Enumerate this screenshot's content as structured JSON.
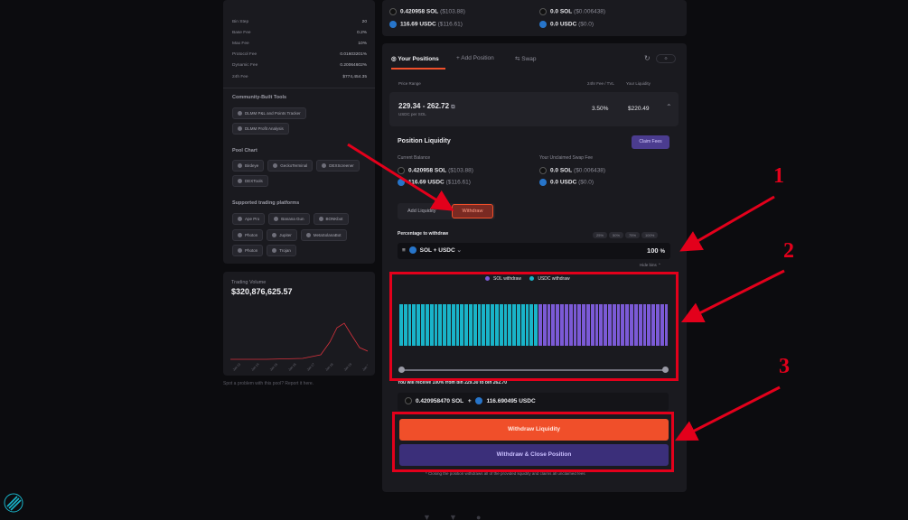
{
  "left_panel": {
    "stats": [
      {
        "label": "Bin Step",
        "value": "20"
      },
      {
        "label": "Base Fee",
        "value": "0.2%"
      },
      {
        "label": "Max Fee",
        "value": "10%"
      },
      {
        "label": "Protocol Fee",
        "value": "0.01603201%"
      },
      {
        "label": "Dynamic Fee",
        "value": "0.20064602%"
      },
      {
        "label": "24h Fee",
        "value": "$774,454.35"
      }
    ],
    "community_title": "Community-Built Tools",
    "community_tools": [
      "DLMM P&L and Points Tracker",
      "DLMM Profit Analysis"
    ],
    "pool_chart_title": "Pool Chart",
    "pool_chart_tools": [
      "Birdeye",
      "GeckoTerminal",
      "DEXScreener",
      "DEXTools"
    ],
    "platforms_title": "Supported trading platforms",
    "platforms": [
      "Ape Pro",
      "Banana Gun",
      "BONKbot",
      "Photon",
      "Jupiter",
      "MetaSolanaBot",
      "Photon",
      "Trojan"
    ]
  },
  "volume_panel": {
    "label": "Trading Volume",
    "value": "$320,876,625.57",
    "dates": [
      "Jan 13",
      "Jan 14",
      "Jan 15",
      "Jan 16",
      "Jan 17",
      "Jan 18",
      "Jan 19",
      "Jan 20"
    ]
  },
  "report_link": "Spot a problem with this pool? Report it here.",
  "balances_top": {
    "sol": "0.420958 SOL",
    "sol_usd": "($103.88)",
    "usdc": "116.69 USDC",
    "usdc_usd": "($116.61)",
    "fee_sol": "0.0 SOL",
    "fee_sol_usd": "($0.006438)",
    "fee_usdc": "0.0 USDC",
    "fee_usdc_usd": "($0.0)"
  },
  "tabs": {
    "positions": "Your Positions",
    "add": "+ Add Position",
    "swap": "Swap"
  },
  "table_headers": {
    "price_range": "Price Range",
    "fee_tvl": "24hr Fee / TVL",
    "liquidity": "Your Liquidity"
  },
  "position": {
    "range": "229.34 - 262.72",
    "unit": "USDC per SOL",
    "fee_pct": "3.50%",
    "liquidity": "$220.49"
  },
  "position_liquidity": {
    "title": "Position Liquidity",
    "claim_fees": "Claim Fees",
    "current_balance": "Current Balance",
    "unclaimed": "Your Unclaimed Swap Fee",
    "sol": "0.420958 SOL",
    "sol_usd": "($103.88)",
    "usdc": "116.69 USDC",
    "usdc_usd": "($116.61)",
    "fee_sol": "0.0 SOL",
    "fee_sol_usd": "($0.006438)",
    "fee_usdc": "0.0 USDC",
    "fee_usdc_usd": "($0.0)"
  },
  "actions": {
    "add_liquidity": "Add Liquidity",
    "withdraw": "Withdraw"
  },
  "withdraw": {
    "pct_label": "Percentage to withdraw",
    "pct_options": [
      "25%",
      "50%",
      "75%",
      "100%"
    ],
    "pair": "SOL + USDC",
    "pct_value": "100",
    "pct_sign": "%",
    "hide_bins": "Hide bins",
    "legend_sol": "SOL withdraw",
    "legend_usdc": "USDC withdraw",
    "receive_text": "You will receive 100% from bin 229.30 to bin 262.70",
    "summary_sol": "0.420958470 SOL",
    "summary_plus": "+",
    "summary_usdc": "116.690495 USDC",
    "withdraw_btn": "Withdraw Liquidity",
    "close_btn": "Withdraw & Close Position",
    "footnote": "* Closing the position withdraws all of the provided liquidity and claims all unclaimed fees"
  },
  "bins": {
    "usdc_count": 32,
    "sol_count": 30
  },
  "annotations": [
    "1",
    "2",
    "3"
  ],
  "colors": {
    "accent_orange": "#f04f2a",
    "close_purple": "#3b2f7a",
    "usdc_bar": "#19b4c9",
    "sol_bar": "#7b5ad6",
    "annotation_red": "#e3001b",
    "claim_purple": "#4b3c8f"
  }
}
